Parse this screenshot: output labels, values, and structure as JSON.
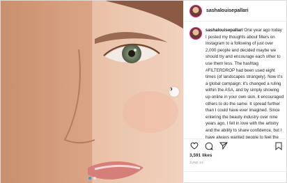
{
  "post": {
    "username": "sashalouisepallari",
    "caption_text": "One year ago today I posted my thoughts about filters on Instagram to a following of just over 2,000 people and decided maybe we should try and encourage each other to use them less. The hashtag #FILTERDROP had been used eight times (of landscapes strangely). Now it's a global campaign: it's changed a ruling within the ASA, and by simply showing up online in your own skin, it encouraged others to do the same. It spread further than I could have ever imagined. Since entering the beauty industry over nine years ago, I fell in love with the artistry and the ability to share confidence, but I have always wanted people to feel the same without it: that has, and always will be",
    "likes": "3,591 likes",
    "date": "JUNE 24"
  },
  "icons": {
    "like": "heart-icon",
    "comment": "comment-icon",
    "share": "share-icon",
    "save": "bookmark-icon",
    "next": "chevron-right-icon"
  },
  "colors": {
    "accent": "#3897f0",
    "border": "#dbdbdb",
    "text": "#262626",
    "muted": "#8e8e8e"
  }
}
